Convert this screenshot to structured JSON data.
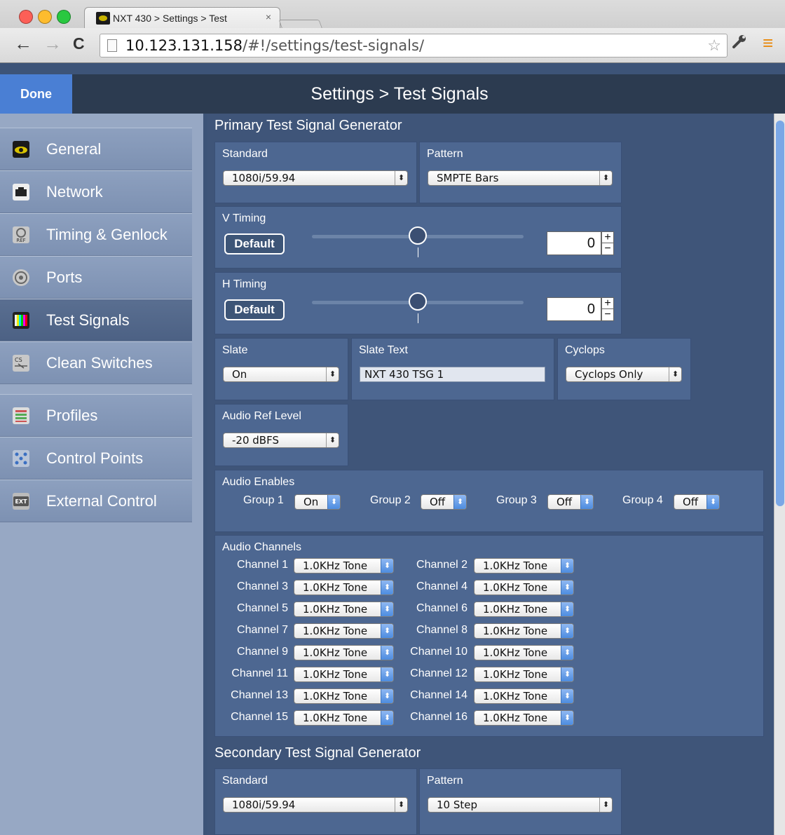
{
  "browser": {
    "tab_title": "NXT 430 > Settings > Test",
    "tab_close": "×",
    "url_host": "10.123.131.158",
    "url_path": "/#!/settings/test-signals/",
    "back_glyph": "←",
    "forward_glyph": "→",
    "reload_glyph": "C",
    "star_glyph": "☆",
    "wrench_glyph": "🔧",
    "menu_glyph": "≡",
    "colors": {
      "close": "#ff5f57",
      "minimize": "#febc2e",
      "zoom": "#28c840"
    }
  },
  "app": {
    "done_label": "Done",
    "title": "Settings > Test Signals"
  },
  "sidebar": {
    "items": [
      {
        "label": "General",
        "icon": "eye-icon"
      },
      {
        "label": "Network",
        "icon": "network-jack-icon"
      },
      {
        "label": "Timing & Genlock",
        "icon": "ref-icon"
      },
      {
        "label": "Ports",
        "icon": "port-icon"
      },
      {
        "label": "Test Signals",
        "icon": "color-bars-icon",
        "active": true
      },
      {
        "label": "Clean Switches",
        "icon": "cs-icon"
      },
      {
        "label": "Profiles",
        "icon": "profiles-icon"
      },
      {
        "label": "Control Points",
        "icon": "control-points-icon"
      },
      {
        "label": "External Control",
        "icon": "ext-icon"
      }
    ]
  },
  "primary": {
    "title": "Primary Test Signal Generator",
    "standard_label": "Standard",
    "standard_value": "1080i/59.94",
    "pattern_label": "Pattern",
    "pattern_value": "SMPTE Bars",
    "vtiming_label": "V Timing",
    "vtiming_default": "Default",
    "vtiming_value": "0",
    "htiming_label": "H Timing",
    "htiming_default": "Default",
    "htiming_value": "0",
    "slate_label": "Slate",
    "slate_value": "On",
    "slate_text_label": "Slate Text",
    "slate_text_value": "NXT 430 TSG 1",
    "cyclops_label": "Cyclops",
    "cyclops_value": "Cyclops Only",
    "audio_ref_label": "Audio Ref Level",
    "audio_ref_value": "-20 dBFS",
    "audio_enables_label": "Audio Enables",
    "groups": [
      {
        "label": "Group 1",
        "value": "On"
      },
      {
        "label": "Group 2",
        "value": "Off"
      },
      {
        "label": "Group 3",
        "value": "Off"
      },
      {
        "label": "Group 4",
        "value": "Off"
      }
    ],
    "audio_channels_label": "Audio Channels",
    "channels": [
      {
        "label": "Channel 1",
        "value": "1.0KHz Tone"
      },
      {
        "label": "Channel 2",
        "value": "1.0KHz Tone"
      },
      {
        "label": "Channel 3",
        "value": "1.0KHz Tone"
      },
      {
        "label": "Channel 4",
        "value": "1.0KHz Tone"
      },
      {
        "label": "Channel 5",
        "value": "1.0KHz Tone"
      },
      {
        "label": "Channel 6",
        "value": "1.0KHz Tone"
      },
      {
        "label": "Channel 7",
        "value": "1.0KHz Tone"
      },
      {
        "label": "Channel 8",
        "value": "1.0KHz Tone"
      },
      {
        "label": "Channel 9",
        "value": "1.0KHz Tone"
      },
      {
        "label": "Channel 10",
        "value": "1.0KHz Tone"
      },
      {
        "label": "Channel 11",
        "value": "1.0KHz Tone"
      },
      {
        "label": "Channel 12",
        "value": "1.0KHz Tone"
      },
      {
        "label": "Channel 13",
        "value": "1.0KHz Tone"
      },
      {
        "label": "Channel 14",
        "value": "1.0KHz Tone"
      },
      {
        "label": "Channel 15",
        "value": "1.0KHz Tone"
      },
      {
        "label": "Channel 16",
        "value": "1.0KHz Tone"
      }
    ]
  },
  "secondary": {
    "title": "Secondary Test Signal Generator",
    "standard_label": "Standard",
    "standard_value": "1080i/59.94",
    "pattern_label": "Pattern",
    "pattern_value": "10 Step"
  },
  "glyphs": {
    "updown": "⬍",
    "plus": "+",
    "minus": "−"
  }
}
